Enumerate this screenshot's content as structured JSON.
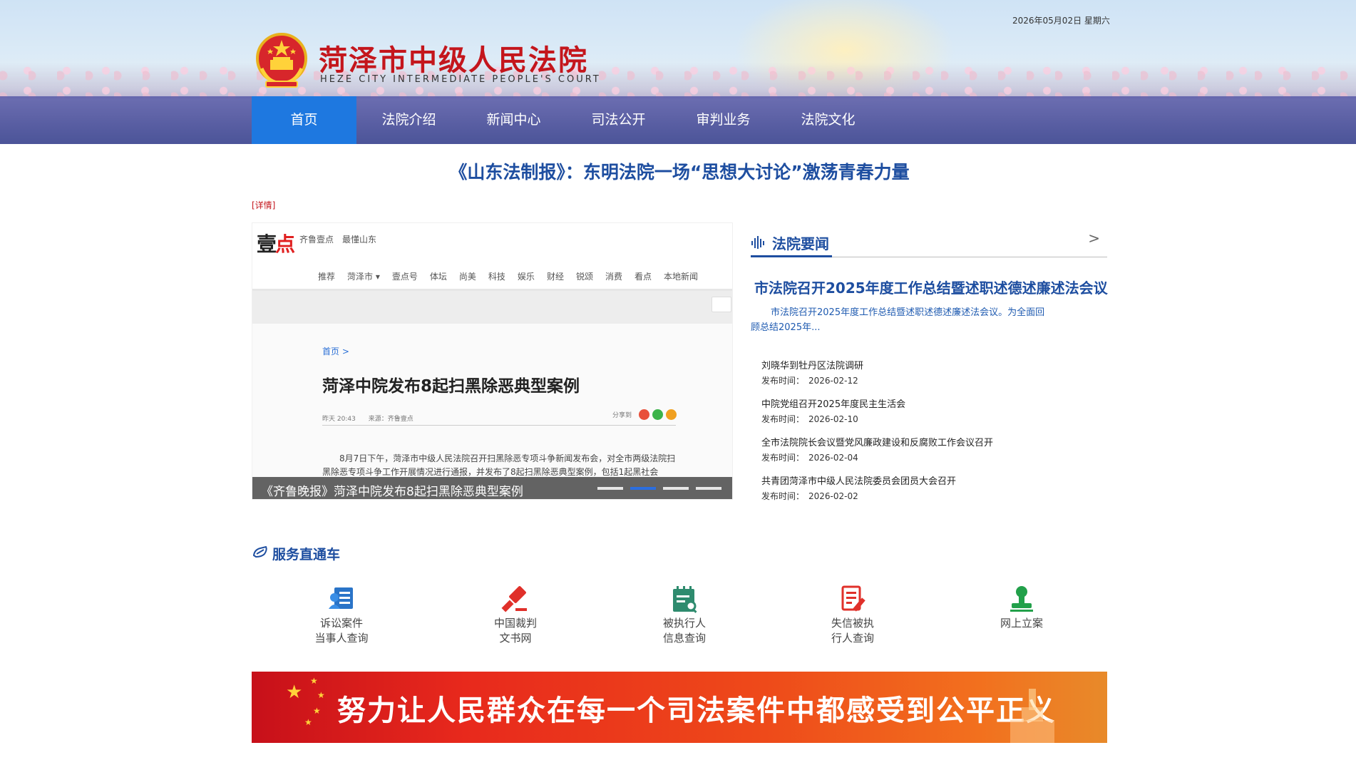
{
  "header": {
    "date": "2026年05月02日 星期六",
    "court_name": "菏泽市中级人民法院",
    "court_name_en": "HEZE CITY INTERMEDIATE PEOPLE'S COURT"
  },
  "nav": {
    "items": [
      {
        "label": "首页"
      },
      {
        "label": "法院介绍"
      },
      {
        "label": "新闻中心"
      },
      {
        "label": "司法公开"
      },
      {
        "label": "审判业务"
      },
      {
        "label": "法院文化"
      }
    ],
    "active_index": 0
  },
  "headline": {
    "title": "《山东法制报》：东明法院一场“思想大讨论”激荡青春力量",
    "detail_link": "[详情]"
  },
  "carousel": {
    "screenshot": {
      "logo_main": "壹",
      "logo_accent": "点",
      "tagline": "齐鲁壹点　最懂山东",
      "menu": [
        "推荐",
        "菏泽市 ▾",
        "壹点号",
        "体坛",
        "尚美",
        "科技",
        "娱乐",
        "财经",
        "锐颂",
        "消费",
        "看点",
        "本地新闻"
      ],
      "crumb": "首页 >",
      "article_title": "菏泽中院发布8起扫黑除恶典型案例",
      "meta": "昨天 20:43　　来源：齐鲁壹点",
      "share_label": "分享到",
      "paragraph": "8月7日下午，菏泽市中级人民法院召开扫黑除恶专项斗争新闻发布会，对全市两级法院扫黑除恶专项斗争工作开展情况进行通报，并发布了8起扫黑除恶典型案例，包括1起黑社会"
    },
    "caption": "《齐鲁晚报》菏泽中院发布8起扫黑除恶典型案例",
    "dots": 4,
    "active_dot": 1
  },
  "news": {
    "section_title": "法院要闻",
    "more": ">",
    "lead_title": "市法院召开2025年度工作总结暨述职述德述廉述法会议",
    "lead_desc": "市法院召开2025年度工作总结暨述职述德述廉述法会议。为全面回顾总结2025年...",
    "items": [
      {
        "title": "刘晓华到牡丹区法院调研",
        "date": "发布时间：　2026-02-12"
      },
      {
        "title": "中院党组召开2025年度民主生活会",
        "date": "发布时间：　2026-02-10"
      },
      {
        "title": "全市法院院长会议暨党风廉政建设和反腐败工作会议召开",
        "date": "发布时间：　2026-02-04"
      },
      {
        "title": "共青团菏泽市中级人民法院委员会团员大会召开",
        "date": "发布时间：　2026-02-02"
      }
    ]
  },
  "services": {
    "title": "服务直通车",
    "items": [
      {
        "line1": "诉讼案件",
        "line2": "当事人查询",
        "icon": "person-card-icon"
      },
      {
        "line1": "中国裁判",
        "line2": "文书网",
        "icon": "gavel-icon"
      },
      {
        "line1": "被执行人",
        "line2": "信息查询",
        "icon": "calendar-search-icon"
      },
      {
        "line1": "失信被执",
        "line2": "行人查询",
        "icon": "document-pen-icon"
      },
      {
        "line1": "网上立案",
        "line2": "",
        "icon": "stamp-icon"
      }
    ]
  },
  "slogan": {
    "text": "努力让人民群众在每一个司法案件中都感受到公平正义"
  },
  "colors": {
    "brand_blue": "#1e4ea0",
    "nav_active": "#1e78e0",
    "court_red": "#c4161c"
  }
}
